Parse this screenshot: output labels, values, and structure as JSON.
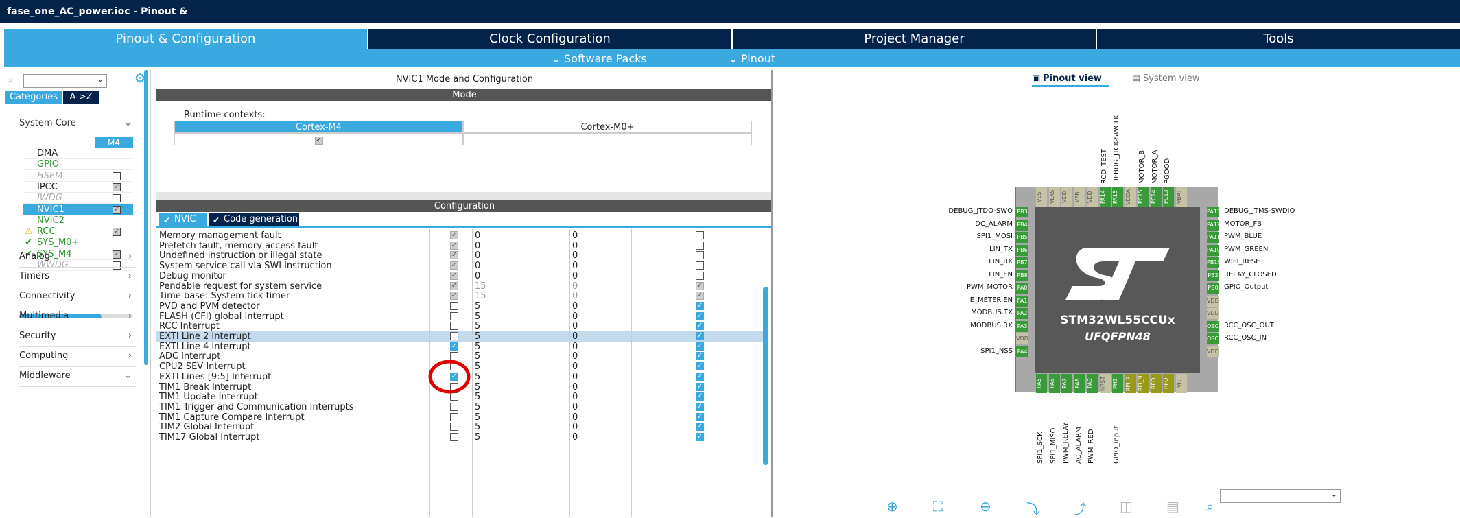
{
  "window": {
    "title": "fase_one_AC_power.ioc - Pinout & Configuration"
  },
  "tabs": [
    "Pinout & Configuration",
    "Clock Configuration",
    "Project Manager",
    "Tools"
  ],
  "subbar": {
    "software_packs": "Software Packs",
    "pinout": "Pinout"
  },
  "left": {
    "categories_tab": "Categories",
    "az_tab": "A->Z",
    "system_core": "System Core",
    "m4_header": "M4",
    "peripherals": [
      {
        "name": "DMA",
        "check": "",
        "style": "normal"
      },
      {
        "name": "GPIO",
        "check": "",
        "style": "green"
      },
      {
        "name": "HSEM",
        "check": "☐",
        "style": "disabled"
      },
      {
        "name": "IPCC",
        "check": "☑",
        "style": "normal"
      },
      {
        "name": "IWDG",
        "check": "☐",
        "style": "disabled"
      },
      {
        "name": "NVIC1",
        "check": "☑",
        "style": "selected"
      },
      {
        "name": "NVIC2",
        "check": "",
        "style": "green"
      },
      {
        "name": "RCC",
        "check": "☑",
        "style": "warn"
      },
      {
        "name": "SYS_M0+",
        "check": "",
        "style": "ok"
      },
      {
        "name": "SYS_M4",
        "check": "☑",
        "style": "ok"
      },
      {
        "name": "WWDG",
        "check": "☐",
        "style": "disabled"
      }
    ],
    "sections": [
      "Analog",
      "Timers",
      "Connectivity",
      "Multimedia",
      "Security",
      "Computing",
      "Middleware"
    ]
  },
  "center": {
    "title": "NVIC1 Mode and Configuration",
    "mode_bar": "Mode",
    "runtime_label": "Runtime contexts:",
    "ctx_m4": "Cortex-M4",
    "ctx_m0": "Cortex-M0+",
    "config_bar": "Configuration",
    "tab_nvic": "NVIC",
    "tab_codegen": "Code generation",
    "rows": [
      {
        "name": "Memory management fault",
        "en": "gray",
        "p": "0",
        "s": "0",
        "h": "off",
        "g": false
      },
      {
        "name": "Prefetch fault, memory access fault",
        "en": "gray",
        "p": "0",
        "s": "0",
        "h": "off",
        "g": false
      },
      {
        "name": "Undefined instruction or illegal state",
        "en": "gray",
        "p": "0",
        "s": "0",
        "h": "off",
        "g": false
      },
      {
        "name": "System service call via SWI instruction",
        "en": "gray",
        "p": "0",
        "s": "0",
        "h": "off",
        "g": false
      },
      {
        "name": "Debug monitor",
        "en": "gray",
        "p": "0",
        "s": "0",
        "h": "off",
        "g": false
      },
      {
        "name": "Pendable request for system service",
        "en": "gray",
        "p": "15",
        "s": "0",
        "h": "gray",
        "g": true
      },
      {
        "name": "Time base: System tick timer",
        "en": "gray",
        "p": "15",
        "s": "0",
        "h": "gray",
        "g": true
      },
      {
        "name": "PVD and PVM detector",
        "en": "off",
        "p": "5",
        "s": "0",
        "h": "on",
        "g": false
      },
      {
        "name": "FLASH (CFI)  global Interrupt",
        "en": "off",
        "p": "5",
        "s": "0",
        "h": "on",
        "g": false
      },
      {
        "name": "RCC Interrupt",
        "en": "off",
        "p": "5",
        "s": "0",
        "h": "on",
        "g": false
      },
      {
        "name": "EXTI Line 2 Interrupt",
        "en": "off",
        "p": "5",
        "s": "0",
        "h": "on",
        "g": false
      },
      {
        "name": "EXTI Line 4 Interrupt",
        "en": "on",
        "p": "5",
        "s": "0",
        "h": "on",
        "g": false
      },
      {
        "name": "ADC Interrupt",
        "en": "off",
        "p": "5",
        "s": "0",
        "h": "on",
        "g": false
      },
      {
        "name": "CPU2 SEV Interrupt",
        "en": "off",
        "p": "5",
        "s": "0",
        "h": "on",
        "g": false
      },
      {
        "name": "EXTI Lines [9:5] Interrupt",
        "en": "on",
        "p": "5",
        "s": "0",
        "h": "on",
        "g": false
      },
      {
        "name": "TIM1 Break Interrupt",
        "en": "off",
        "p": "5",
        "s": "0",
        "h": "on",
        "g": false
      },
      {
        "name": "TIM1 Update Interrupt",
        "en": "off",
        "p": "5",
        "s": "0",
        "h": "on",
        "g": false
      },
      {
        "name": "TIM1 Trigger and Communication Interrupts",
        "en": "off",
        "p": "5",
        "s": "0",
        "h": "on",
        "g": false
      },
      {
        "name": "TIM1 Capture Compare Interrupt",
        "en": "off",
        "p": "5",
        "s": "0",
        "h": "on",
        "g": false
      },
      {
        "name": "TIM2 Global Interrupt",
        "en": "off",
        "p": "5",
        "s": "0",
        "h": "on",
        "g": false
      },
      {
        "name": "TIM17 Global Interrupt",
        "en": "off",
        "p": "5",
        "s": "0",
        "h": "on",
        "g": false
      }
    ]
  },
  "right": {
    "pinout_view": "Pinout view",
    "system_view": "System view",
    "chip_name": "STM32WL55CCUx",
    "package": "UFQFPN48",
    "left_labels": [
      "DEBUG_JTDO-SWO",
      "DC_ALARM",
      "SPI1_MOSI",
      "LIN_TX",
      "LIN_RX",
      "LIN_EN",
      "PWM_MOTOR",
      "E_METER.EN",
      "MODBUS.TX",
      "MODBUS.RX",
      "SPI1_NSS"
    ],
    "right_labels": [
      "DEBUG_JTMS-SWDIO",
      "MOTOR_FB",
      "PWM_BLUE",
      "PWM_GREEN",
      "WIFI_RESET",
      "RELAY_CLOSED",
      "GPIO_Output",
      "RCC_OSC_OUT",
      "RCC_OSC_IN"
    ],
    "top_labels": [
      "RCD_TEST",
      "DEBUG_JTCK-SWCLK",
      "MOTOR_B",
      "MOTOR_A",
      "PGOOD"
    ],
    "bottom_labels": [
      "SPI1_SCK",
      "SPI1_MISO",
      "PWM_RELAY",
      "AC_ALARM",
      "PWM_RED",
      "GPIO_Input"
    ],
    "left_pins": [
      "PB3",
      "PB4",
      "PB5",
      "PB6",
      "PB7",
      "PB8",
      "PA0",
      "PA1",
      "PA2",
      "PA3",
      "VDD",
      "PA4"
    ],
    "right_pins": [
      "PA13",
      "PA12",
      "PA11",
      "PA10",
      "PB15",
      "PB2",
      "PB0",
      "VDD..",
      "VDD..",
      "OSC..",
      "OSC..",
      "VDD.."
    ],
    "top_pins": [
      "VSS",
      "VLXS",
      "VDD",
      "VFB",
      "VDD",
      "PA14",
      "PA15",
      "VDDA",
      "PC15",
      "PC14",
      "PC13",
      "VBAT"
    ],
    "bottom_pins": [
      "PA5",
      "PA6",
      "PA7",
      "PA8",
      "PA9",
      "NRST",
      "PH3",
      "RFI_P",
      "RFI_N",
      "RFO",
      "RFO",
      "VR"
    ]
  }
}
